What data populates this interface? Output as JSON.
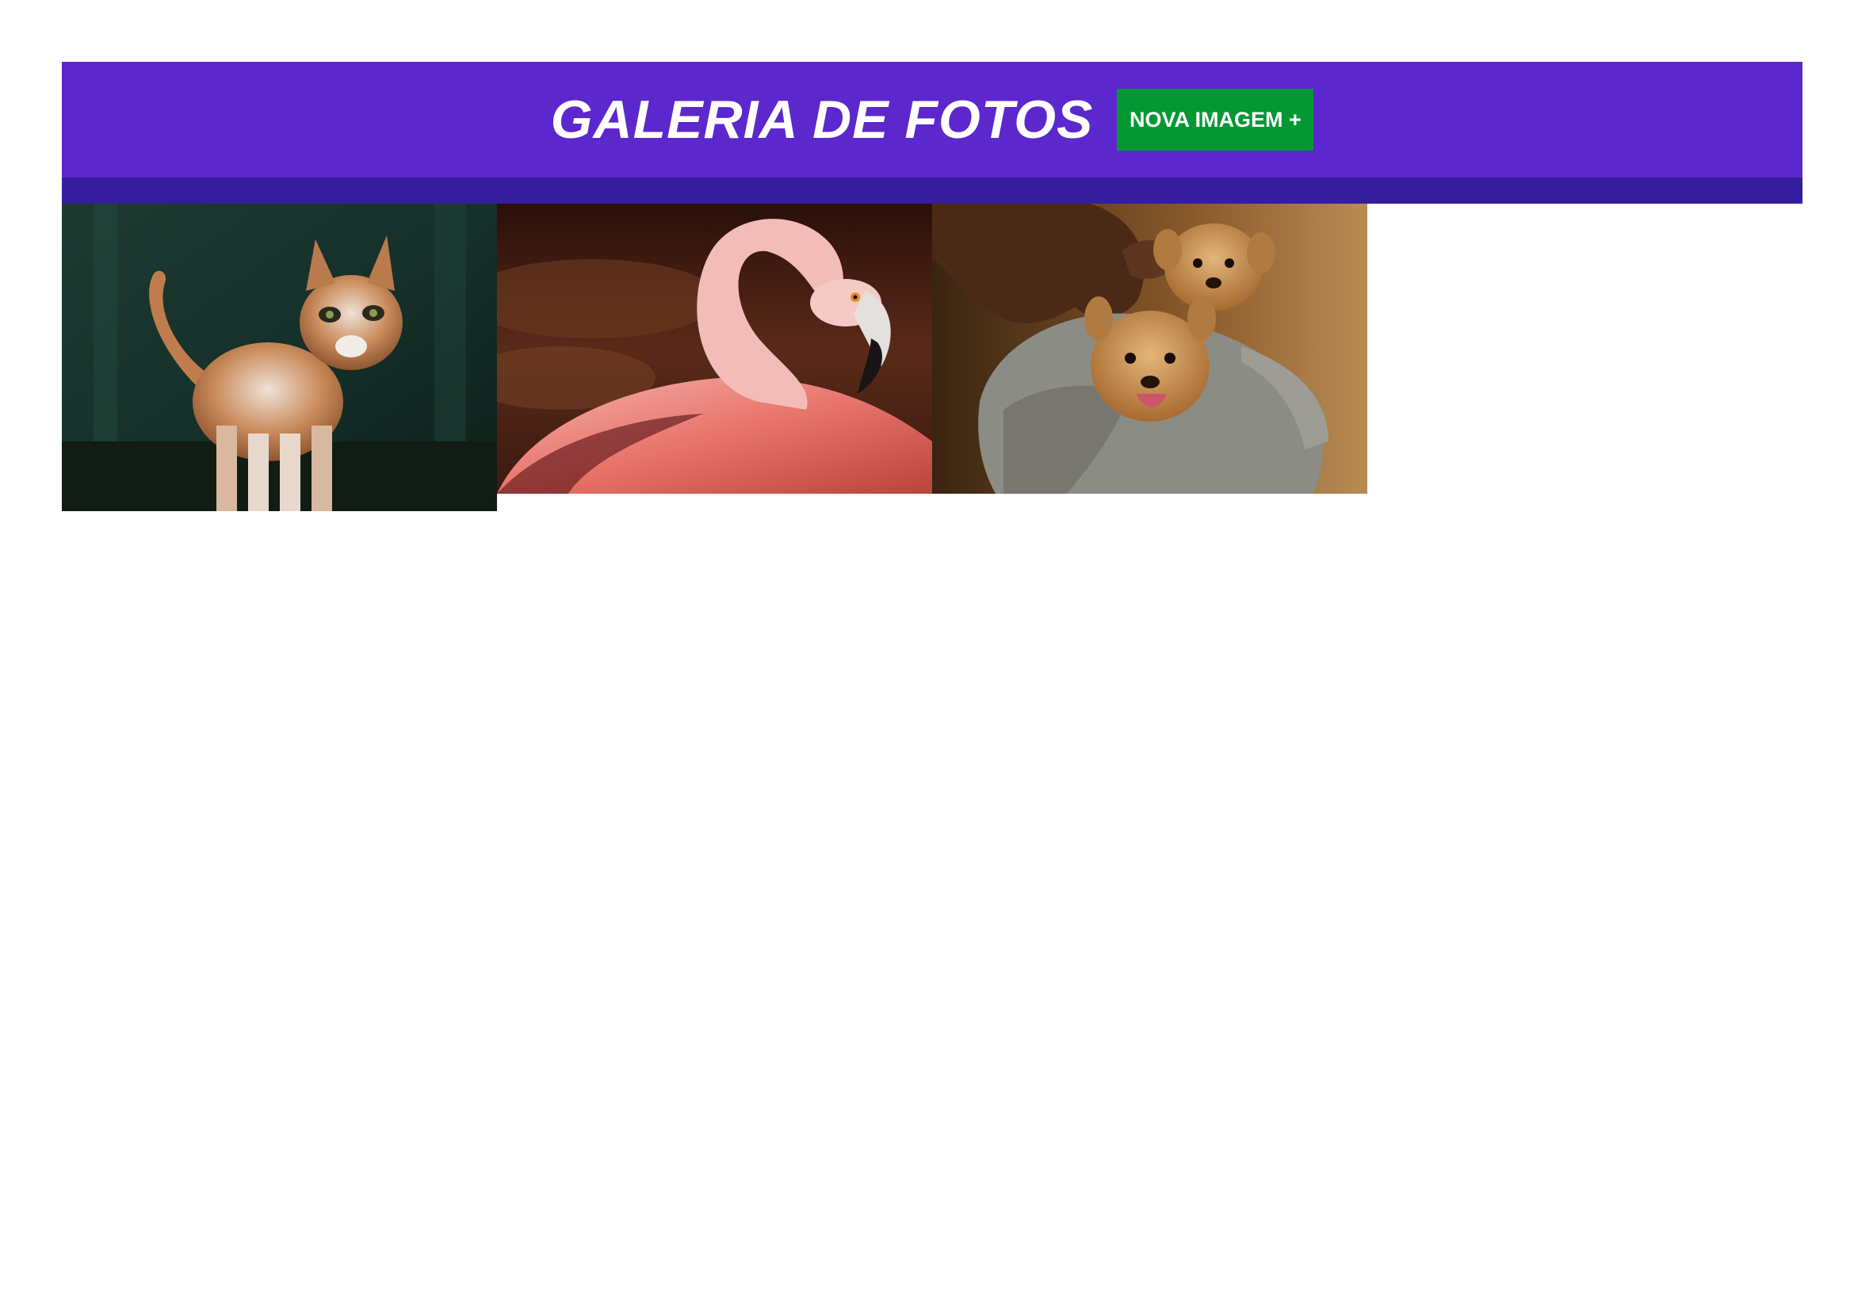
{
  "header": {
    "title": "GALERIA DE FOTOS",
    "new_image_label": "NOVA IMAGEM +"
  },
  "colors": {
    "header_bg": "#5c28cd",
    "header_shadow": "#341e9d",
    "button_bg": "#039834",
    "text": "#ffffff"
  },
  "gallery": {
    "photos": [
      {
        "subject": "cat"
      },
      {
        "subject": "flamingo"
      },
      {
        "subject": "puppies"
      }
    ]
  }
}
